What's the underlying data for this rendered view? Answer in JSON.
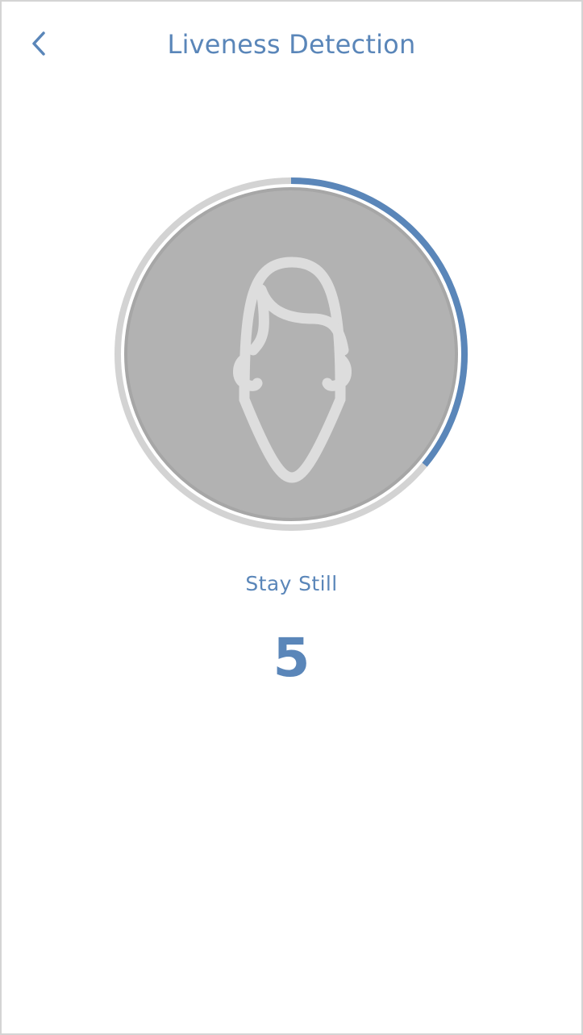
{
  "header": {
    "title": "Liveness Detection",
    "back_icon": "chevron-left-icon"
  },
  "scanner": {
    "progress_fraction": 0.36,
    "face_icon": "face-outline-icon"
  },
  "status": {
    "instruction": "Stay Still",
    "countdown": "5"
  },
  "colors": {
    "accent": "#5a86b9",
    "track": "#d3d3d3",
    "ring_gap": "#ffffff",
    "camera_fill": "#b2b2b2",
    "face_stroke": "#dddddd",
    "background": "#ffffff"
  }
}
